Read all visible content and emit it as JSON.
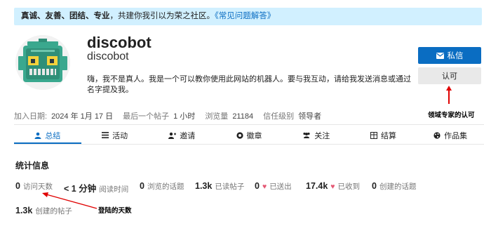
{
  "banner": {
    "bold_text": "真诚、友善、团结、专业",
    "rest_text": "，共建你我引以为荣之社区。",
    "link_text": "《常见问题解答》"
  },
  "profile": {
    "username": "discobot",
    "full_name": "discobot",
    "bio": "嗨，我不是真人。我是一个可以教你使用此网站的机器人。要与我互动，请给我发送消息或通过名字提及我。"
  },
  "actions": {
    "message_label": "私信",
    "approve_label": "认可"
  },
  "annotations": {
    "approve_note": "领域专家的认可",
    "days_note": "登陆的天数"
  },
  "meta": {
    "joined_label": "加入日期:",
    "joined_value": "2024 年 1月 17 日",
    "last_post_label": "最后一个帖子",
    "last_post_value": "1 小时",
    "views_label": "浏览量",
    "views_value": "21184",
    "trust_label": "信任级别",
    "trust_value": "领导者"
  },
  "nav": {
    "tabs": [
      {
        "label": "总结",
        "icon": "user-icon",
        "active": true
      },
      {
        "label": "活动",
        "icon": "list-icon",
        "active": false
      },
      {
        "label": "邀请",
        "icon": "user-plus-icon",
        "active": false
      },
      {
        "label": "徽章",
        "icon": "certificate-icon",
        "active": false
      },
      {
        "label": "关注",
        "icon": "users-icon",
        "active": false
      },
      {
        "label": "结算",
        "icon": "table-icon",
        "active": false
      },
      {
        "label": "作品集",
        "icon": "palette-icon",
        "active": false
      }
    ]
  },
  "stats": {
    "title": "统计信息",
    "items": [
      {
        "num": "0",
        "label": "访问天数"
      },
      {
        "num": "< 1 分钟",
        "label": "阅读时间"
      },
      {
        "num": "0",
        "label": "浏览的话题"
      },
      {
        "num": "1.3k",
        "label": "已读帖子"
      },
      {
        "num": "0",
        "label": "已送出",
        "heart": "♥"
      },
      {
        "num": "17.4k",
        "label": "已收到",
        "heart": "♥"
      },
      {
        "num": "0",
        "label": "创建的话题"
      },
      {
        "num": "1.3k",
        "label": "创建的帖子"
      }
    ]
  },
  "colors": {
    "accent": "#0a6dc2",
    "banner_bg": "#d1f0ff",
    "annotation": "#e00000",
    "heart": "#e45773",
    "robot_teal": "#3aa88e"
  }
}
